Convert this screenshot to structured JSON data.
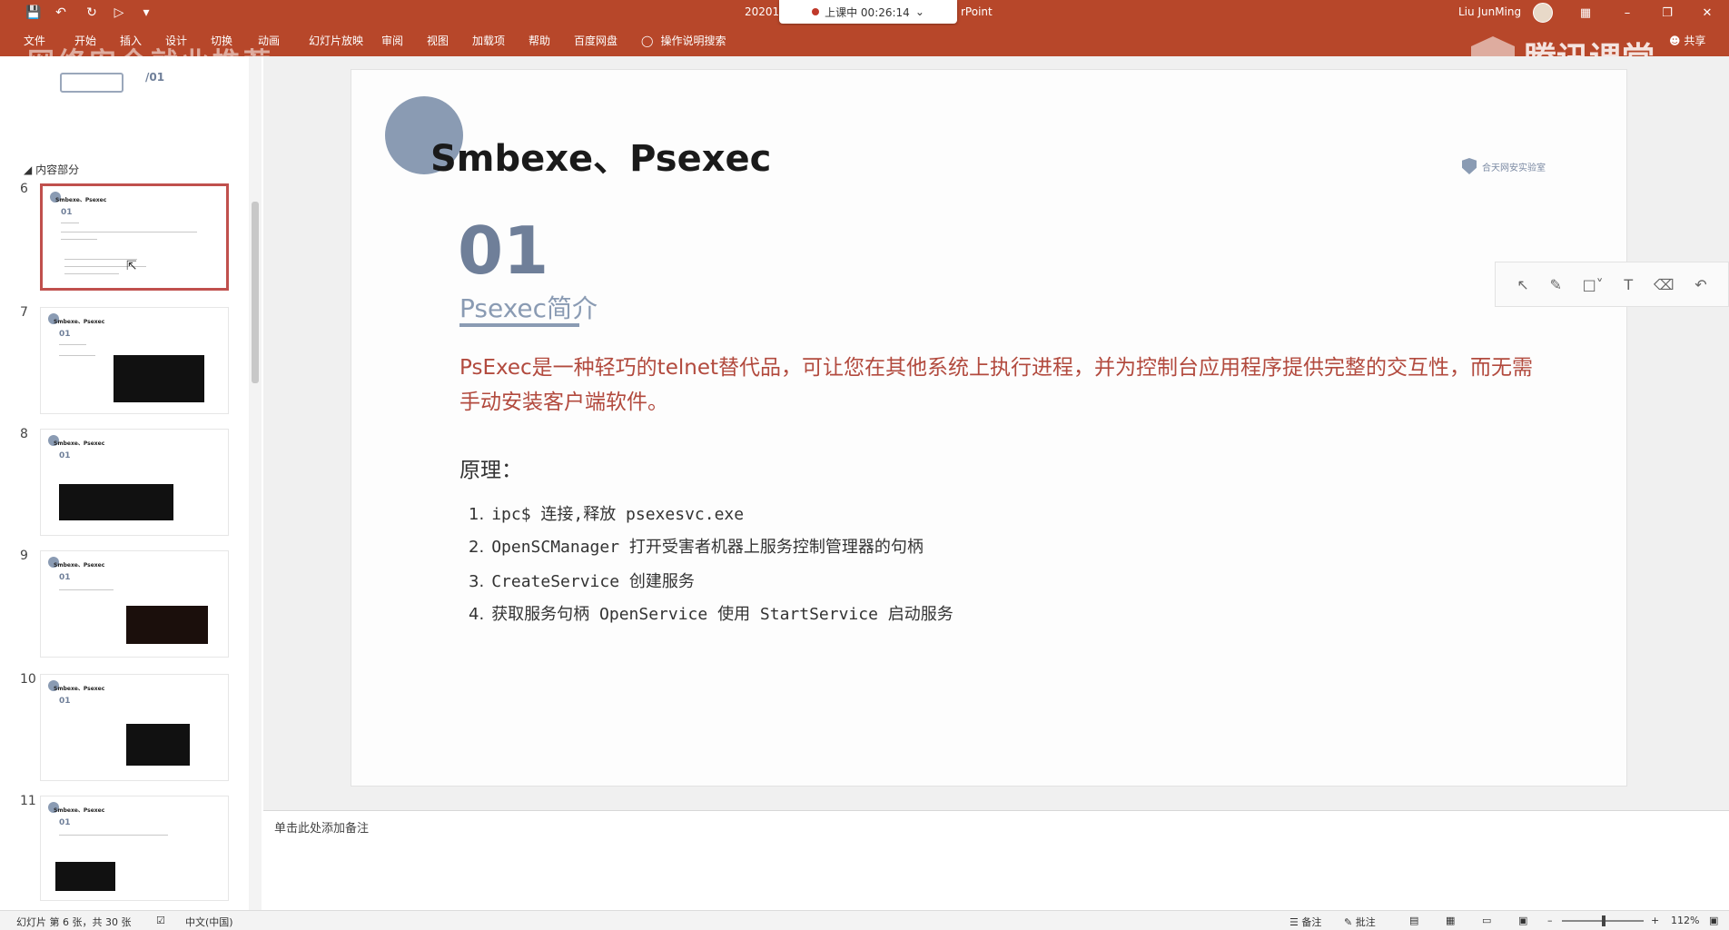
{
  "titlebar": {
    "doc_title": "20201",
    "doc_title_suffix": "rPoint",
    "recording": "上课中 00:26:14",
    "user": "Liu JunMing"
  },
  "ribbon": {
    "tabs": [
      "文件",
      "开始",
      "插入",
      "设计",
      "切换",
      "动画",
      "幻灯片放映",
      "审阅",
      "视图",
      "加载项",
      "帮助",
      "百度网盘"
    ],
    "tell_me": "操作说明搜索",
    "share": "共享"
  },
  "watermark": "腾讯课堂",
  "overlay_text": "网络安全就业推荐",
  "thumbs": {
    "section": "内容部分",
    "slide_title": "Smbexe、Psexec",
    "number_badge": "01",
    "top_badge": "/01",
    "items": [
      {
        "num": "6"
      },
      {
        "num": "7"
      },
      {
        "num": "8"
      },
      {
        "num": "9"
      },
      {
        "num": "10"
      },
      {
        "num": "11"
      }
    ]
  },
  "slide": {
    "title": "Smbexe、Psexec",
    "logo_text": "合天网安实验室",
    "big_num": "01",
    "subheading": "Psexec简介",
    "description": "PsExec是一种轻巧的telnet替代品，可让您在其他系统上执行进程，并为控制台应用程序提供完整的交互性，而无需手动安装客户端软件。",
    "principle_label": "原理：",
    "steps": [
      {
        "n": "1.",
        "text": "ipc$ 连接,释放 psexesvc.exe"
      },
      {
        "n": "2.",
        "text": "OpenSCManager 打开受害者机器上服务控制管理器的句柄"
      },
      {
        "n": "3.",
        "text": "CreateService 创建服务"
      },
      {
        "n": "4.",
        "text": "获取服务句柄 OpenService 使用 StartService 启动服务"
      }
    ]
  },
  "notes_placeholder": "单击此处添加备注",
  "status": {
    "slide_info": "幻灯片 第 6 张，共 30 张",
    "language": "中文(中国)",
    "notes": "备注",
    "comments": "批注",
    "zoom": "112%"
  },
  "icons": {
    "save": "save-icon",
    "undo": "undo-icon",
    "redo": "redo-icon",
    "lightbulb": "lightbulb-icon"
  },
  "colors": {
    "ribbon": "#b7472a",
    "accent_blue": "#8a9bb3",
    "desc_red": "#b24a3e"
  }
}
